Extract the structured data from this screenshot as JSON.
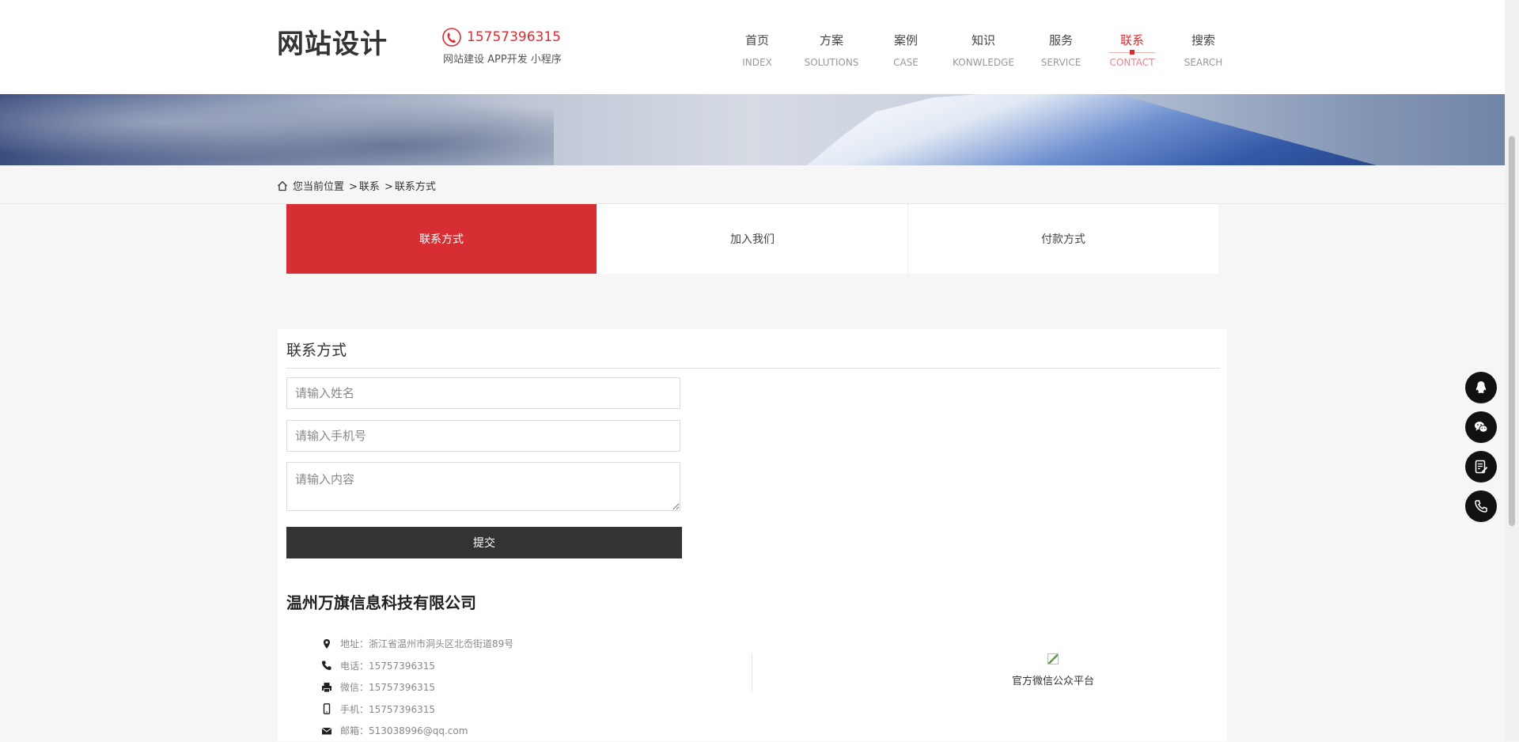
{
  "header": {
    "logo_text": "网站设计",
    "phone": "15757396315",
    "services_text": "网站建设 APP开发 小程序"
  },
  "nav": {
    "items": [
      {
        "cn": "首页",
        "en": "INDEX",
        "active": false
      },
      {
        "cn": "方案",
        "en": "SOLUTIONS",
        "active": false
      },
      {
        "cn": "案例",
        "en": "CASE",
        "active": false
      },
      {
        "cn": "知识",
        "en": "KONWLEDGE",
        "active": false
      },
      {
        "cn": "服务",
        "en": "SERVICE",
        "active": false
      },
      {
        "cn": "联系",
        "en": "CONTACT",
        "active": true
      },
      {
        "cn": "搜索",
        "en": "SEARCH",
        "active": false
      }
    ]
  },
  "breadcrumb": {
    "prefix": "您当前位置",
    "sep": ">",
    "items": [
      "联系",
      "联系方式"
    ]
  },
  "tabs": [
    {
      "label": "联系方式",
      "active": true
    },
    {
      "label": "加入我们",
      "active": false
    },
    {
      "label": "付款方式",
      "active": false
    }
  ],
  "form": {
    "title": "联系方式",
    "name_placeholder": "请输入姓名",
    "phone_placeholder": "请输入手机号",
    "content_placeholder": "请输入内容",
    "submit_label": "提交"
  },
  "company": {
    "name": "温州万旗信息科技有限公司",
    "info": [
      {
        "icon": "location-pin-icon",
        "text": "地址：浙江省温州市洞头区北岙街道89号"
      },
      {
        "icon": "phone-icon",
        "text": "电话：15757396315"
      },
      {
        "icon": "printer-icon",
        "text": "微信：15757396315"
      },
      {
        "icon": "mobile-icon",
        "text": "手机：15757396315"
      },
      {
        "icon": "envelope-icon",
        "text": "邮箱：513038996@qq.com"
      }
    ],
    "qr_label": "官方微信公众平台"
  },
  "float_bar": [
    "qq-icon",
    "wechat-icon",
    "message-icon",
    "phone-icon"
  ],
  "colors": {
    "accent": "#d72e33",
    "dark": "#333333",
    "float_bg": "#111111"
  }
}
